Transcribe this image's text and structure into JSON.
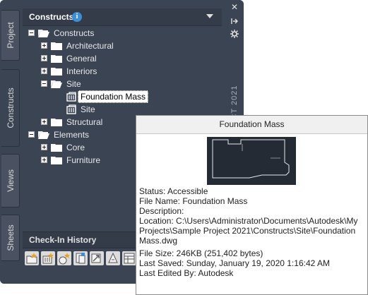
{
  "side_tabs": {
    "project": "Project",
    "constructs": "Constructs",
    "views": "Views",
    "sheets": "Sheets"
  },
  "pane": {
    "title": "Constructs",
    "info_icon": "i"
  },
  "tree": {
    "root": "Constructs",
    "architectural": "Architectural",
    "general": "General",
    "interiors": "Interiors",
    "site": "Site",
    "foundation_mass": "Foundation Mass",
    "site_obj": "Site",
    "structural": "Structural",
    "elements": "Elements",
    "core": "Core",
    "furniture": "Furniture"
  },
  "checkin": {
    "label": "Check-In History"
  },
  "right_strip": {
    "close": "✕",
    "title_fragment": "CT 2021"
  },
  "tooltip": {
    "title": "Foundation Mass",
    "status": "Status: Accessible",
    "file_name": "File Name: Foundation Mass",
    "description": "Description:",
    "location_1": "Location: C:\\Users\\Administrator\\Documents\\Autodesk\\My",
    "location_2": "Projects\\Sample Project 2021\\Constructs\\Site\\Foundation",
    "location_3": "Mass.dwg",
    "file_size": "File Size: 246KB (251,402 bytes)",
    "last_saved": "Last Saved: Sunday, January 19, 2020  1:16:42 AM",
    "last_edited": "Last Edited By: Autodesk"
  },
  "colors": {
    "palette_bg": "#3b4453",
    "accent_blue": "#3a8fd6",
    "refresh_green": "#3cb043"
  }
}
